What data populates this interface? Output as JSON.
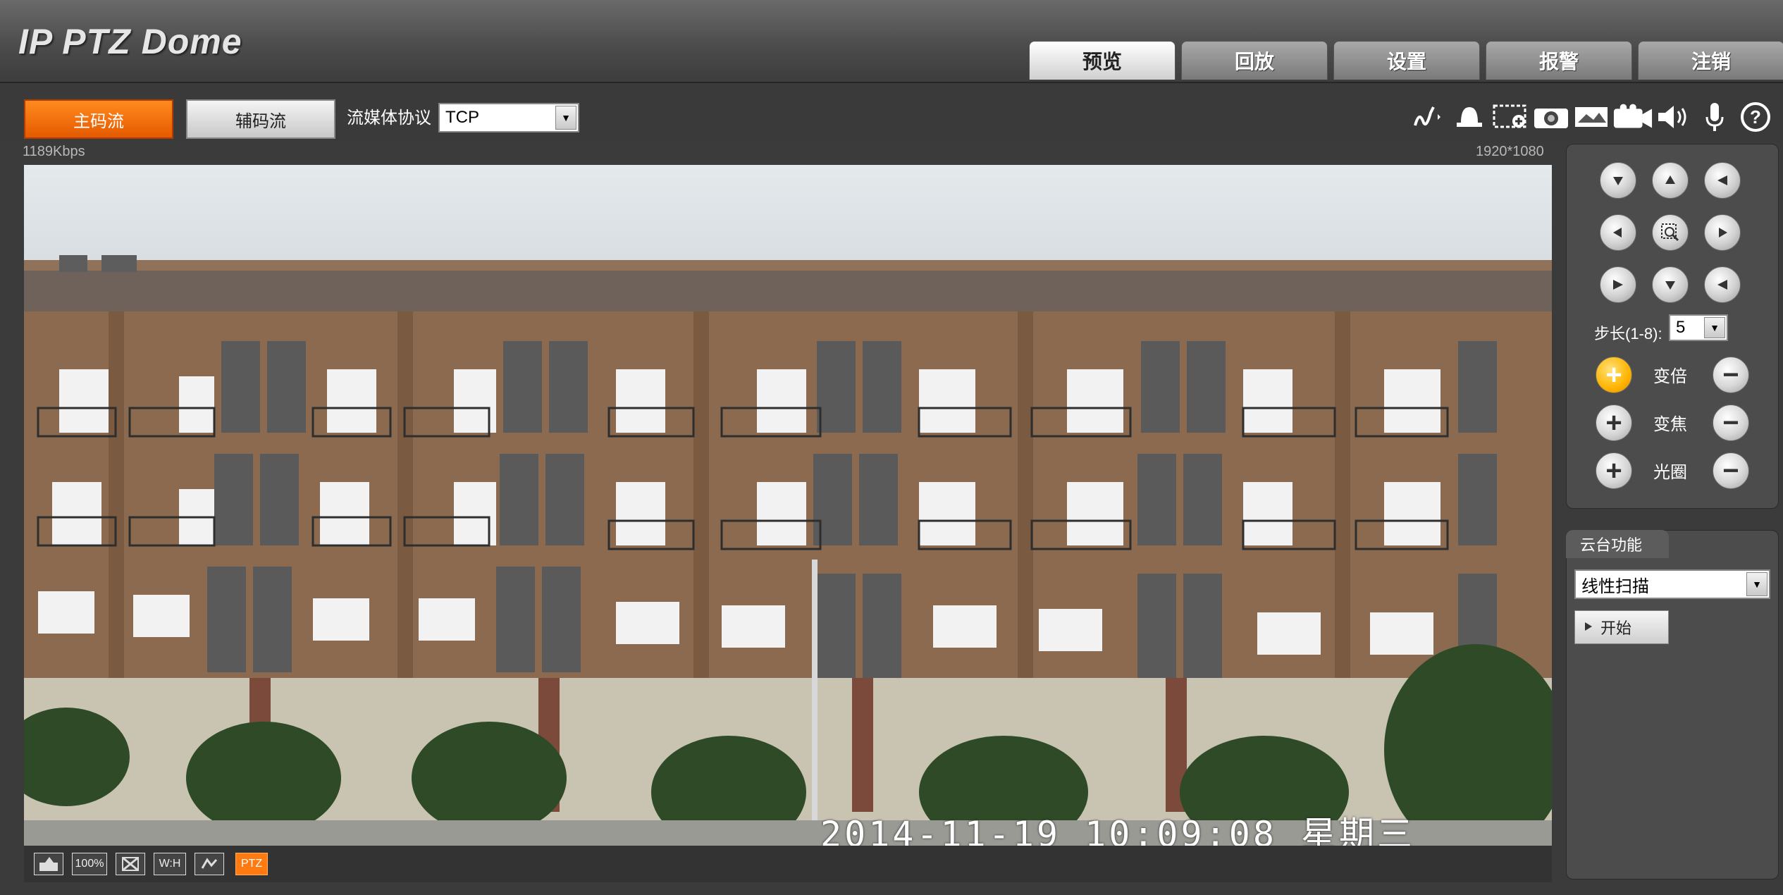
{
  "header": {
    "logo": "IP PTZ Dome",
    "tabs": [
      "预览",
      "回放",
      "设置",
      "报警",
      "注销"
    ]
  },
  "stream": {
    "main_label": "主码流",
    "sub_label": "辅码流",
    "protocol_label": "流媒体协议",
    "protocol_value": "TCP"
  },
  "video": {
    "bitrate": "1189Kbps",
    "resolution": "1920*1080",
    "osd_timestamp": "2014-11-19 10:09:08 星期三"
  },
  "toolbar_icons": [
    "draw-icon",
    "alarm-light-icon",
    "zoom-region-icon",
    "snapshot-icon",
    "triple-snapshot-icon",
    "record-icon",
    "speaker-icon",
    "microphone-icon",
    "help-icon"
  ],
  "bottom_bar": {
    "zoom_100": "100%",
    "wh": "W:H",
    "ptz": "PTZ"
  },
  "ptz": {
    "step_label": "步长(1-8):",
    "step_value": "5",
    "zoom_label": "变倍",
    "focus_label": "变焦",
    "iris_label": "光圈"
  },
  "ptz_function": {
    "tab_label": "云台功能",
    "selected": "线性扫描",
    "start_label": "开始"
  },
  "colors": {
    "accent": "#ff7a10",
    "active_tab": "#ececec"
  }
}
